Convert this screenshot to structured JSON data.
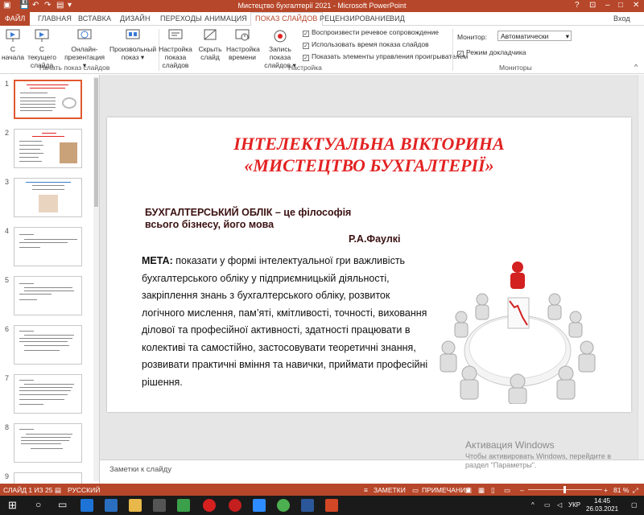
{
  "window": {
    "title": "Мистецтво бухгалтерії 2021 - Microsoft PowerPoint",
    "signin": "Вход"
  },
  "tabs": [
    "ФАЙЛ",
    "ГЛАВНАЯ",
    "ВСТАВКА",
    "ДИЗАЙН",
    "ПЕРЕХОДЫ",
    "АНИМАЦИЯ",
    "ПОКАЗ СЛАЙДОВ",
    "РЕЦЕНЗИРОВАНИЕ",
    "ВИД"
  ],
  "ribbon": {
    "start_group": {
      "label": "Начать показ слайдов",
      "buttons": [
        {
          "line1": "С",
          "line2": "начала"
        },
        {
          "line1": "С текущего",
          "line2": "слайда"
        },
        {
          "line1": "Онлайн-",
          "line2": "презентация ▾"
        },
        {
          "line1": "Произвольный",
          "line2": "показ ▾"
        }
      ]
    },
    "setup_group": {
      "label": "Настройка",
      "buttons": [
        {
          "line1": "Настройка",
          "line2": "показа слайдов"
        },
        {
          "line1": "Скрыть",
          "line2": "слайд"
        },
        {
          "line1": "Настройка",
          "line2": "времени"
        },
        {
          "line1": "Запись показа",
          "line2": "слайдов ▾"
        }
      ],
      "checks": [
        {
          "label": "Воспроизвести речевое сопровождение",
          "checked": true
        },
        {
          "label": "Использовать время показа слайдов",
          "checked": true
        },
        {
          "label": "Показать элементы управления проигрывателем",
          "checked": true
        }
      ]
    },
    "monitors_group": {
      "label": "Мониторы",
      "monitor_label": "Монитор:",
      "monitor_value": "Автоматически",
      "presenter_label": "Режим докладчика",
      "presenter_checked": true
    }
  },
  "thumbnails": [
    "1",
    "2",
    "3",
    "4",
    "5",
    "6",
    "7",
    "8",
    "9"
  ],
  "slide": {
    "title1": "ІНТЕЛЕКТУАЛЬНА ВІКТОРИНА",
    "title2": "«МИСТЕЦТВО БУХГАЛТЕРІЇ»",
    "subtitle1": "БУХГАЛТЕРСЬКИЙ ОБЛІК – це філософія",
    "subtitle2": "всього бізнесу, його мова",
    "author": "Р.А.Фаулкі",
    "goal_label": "МЕТА:",
    "goal_text": "показати у формі інтелектуальної гри важливість бухгалтерського обліку у підприємницькій діяльності, закріплення знань з бухгалтерського обліку, розвиток логічного мислення, пам’яті, кмітливості, точності, виховання ділової та професійної активності, здатності працювати в колективі та самостійно, застосовувати теоретичні знання, розвивати практичні вміння та навички, приймати професійні  рішення."
  },
  "notes_placeholder": "Заметки к слайду",
  "activation": {
    "line1": "Активация Windows",
    "line2": "Чтобы активировать Windows, перейдите в",
    "line3": "раздел \"Параметры\"."
  },
  "status": {
    "slide": "СЛАЙД 1 ИЗ 25",
    "lang": "РУССКИЙ",
    "notes": "ЗАМЕТКИ",
    "comments": "ПРИМЕЧАНИЯ",
    "zoom": "81 %"
  },
  "tray": {
    "lang": "УКР",
    "time": "14:45",
    "date": "26.03.2021"
  },
  "colors": {
    "accent": "#b7472a",
    "title_red": "#e32222"
  }
}
